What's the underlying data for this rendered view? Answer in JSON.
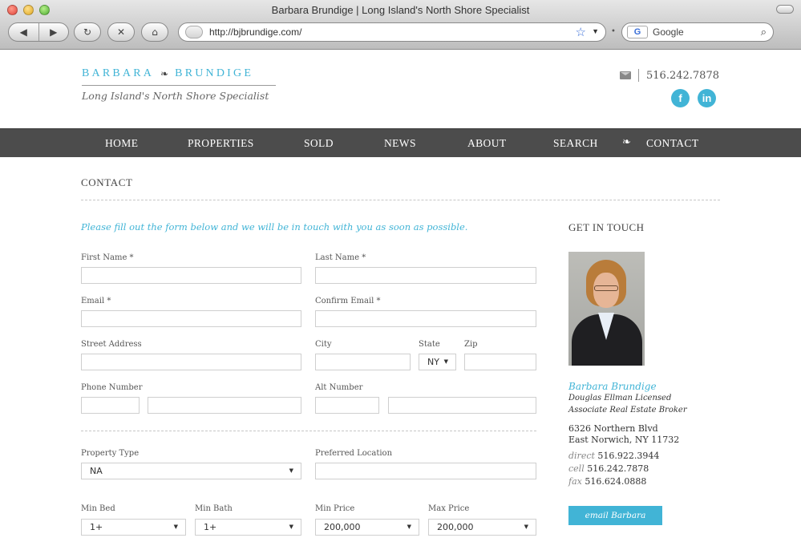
{
  "browser": {
    "window_title": "Barbara Brundige | Long Island's North Shore Specialist",
    "url": "http://bjbrundige.com/",
    "search_placeholder": "Google",
    "search_engine_badge": "G"
  },
  "header": {
    "logo_first": "BARBARA",
    "logo_last": "BRUNDIGE",
    "logo_tagline": "Long Island's North Shore Specialist",
    "phone": "516.242.7878",
    "social": [
      {
        "icon": "facebook-icon",
        "glyph": "f"
      },
      {
        "icon": "linkedin-icon",
        "glyph": "in"
      }
    ],
    "accent_color": "#41b4d6"
  },
  "nav": {
    "home": "HOME",
    "properties": "PROPERTIES",
    "sold": "SOLD",
    "news": "NEWS",
    "about": "ABOUT",
    "search": "SEARCH",
    "contact": "CONTACT"
  },
  "page": {
    "title": "CONTACT",
    "intro": "Please fill out the form below and we will be in touch with you as soon as possible."
  },
  "form": {
    "first_name_label": "First Name *",
    "last_name_label": "Last Name *",
    "email_label": "Email *",
    "confirm_email_label": "Confirm Email *",
    "street_label": "Street Address",
    "city_label": "City",
    "state_label": "State",
    "state_value": "NY",
    "zip_label": "Zip",
    "phone_label": "Phone Number",
    "alt_label": "Alt Number",
    "property_type_label": "Property Type",
    "property_type_value": "NA",
    "preferred_location_label": "Preferred Location",
    "min_bed_label": "Min Bed",
    "min_bed_value": "1+",
    "min_bath_label": "Min Bath",
    "min_bath_value": "1+",
    "min_price_label": "Min Price",
    "min_price_value": "200,000",
    "max_price_label": "Max Price",
    "max_price_value": "200,000"
  },
  "sidebar": {
    "title": "GET IN TOUCH",
    "agent_name": "Barbara Brundige",
    "agent_line1": "Douglas Ellman Licensed",
    "agent_line2": "Associate Real Estate Broker",
    "address1": "6326 Northern Blvd",
    "address2": "East Norwich, NY 11732",
    "direct_label": "direct",
    "direct": "516.922.3944",
    "cell_label": "cell",
    "cell": "516.242.7878",
    "fax_label": "fax",
    "fax": "516.624.0888",
    "email_button": "email Barbara"
  }
}
